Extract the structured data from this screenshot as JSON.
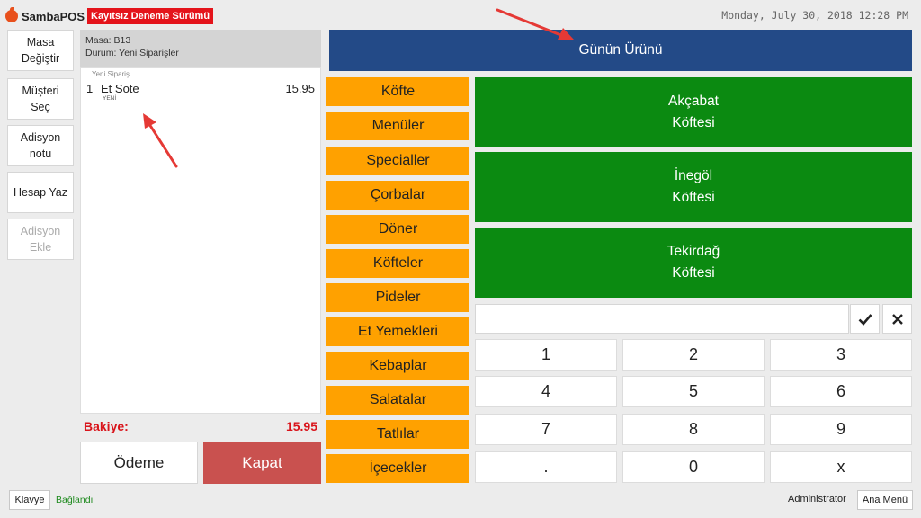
{
  "header": {
    "app_name": "SambaPOS",
    "trial_badge": "Kayıtsız Deneme Sürümü",
    "datetime": "Monday, July 30, 2018 12:28 PM"
  },
  "actions": [
    {
      "label_1": "Masa",
      "label_2": "Değiştir"
    },
    {
      "label_1": "Müşteri",
      "label_2": "Seç"
    },
    {
      "label_1": "Adisyon",
      "label_2": "notu"
    },
    {
      "label_1": "Hesap Yaz",
      "label_2": ""
    },
    {
      "label_1": "Adisyon",
      "label_2": "Ekle"
    }
  ],
  "ticket": {
    "table_line": "Masa: B13",
    "status_line": "Durum: Yeni Siparişler",
    "group_label": "Yeni Sipariş",
    "orders": [
      {
        "qty": "1",
        "name": "Et Sote",
        "price": "15.95",
        "status": "YENİ"
      }
    ],
    "balance_label": "Bakiye:",
    "balance_value": "15.95",
    "pay_label": "Ödeme",
    "close_label": "Kapat"
  },
  "banner": {
    "label": "Günün Ürünü"
  },
  "categories": [
    "Köfte",
    "Menüler",
    "Specialler",
    "Çorbalar",
    "Döner",
    "Köfteler",
    "Pideler",
    "Et Yemekleri",
    "Kebaplar",
    "Salatalar",
    "Tatlılar",
    "İçecekler"
  ],
  "products": [
    {
      "line_1": "Akçabat",
      "line_2": "Köftesi"
    },
    {
      "line_1": "İnegöl",
      "line_2": "Köftesi"
    },
    {
      "line_1": "Tekirdağ",
      "line_2": "Köftesi"
    }
  ],
  "numpad": {
    "input_value": "",
    "keys": [
      "1",
      "2",
      "3",
      "4",
      "5",
      "6",
      "7",
      "8",
      "9",
      ".",
      "0",
      "x"
    ]
  },
  "footer": {
    "keyboard_label": "Klavye",
    "connection_status": "Bağlandı",
    "user": "Administrator",
    "main_menu_label": "Ana Menü"
  },
  "colors": {
    "banner": "#234a87",
    "category": "#ffa100",
    "product": "#0b8a11",
    "close_button": "#c9514f",
    "balance": "#d9141b",
    "trial_badge": "#e4141b",
    "connected": "#1e8a1e",
    "annotation_arrow": "#e53935"
  }
}
